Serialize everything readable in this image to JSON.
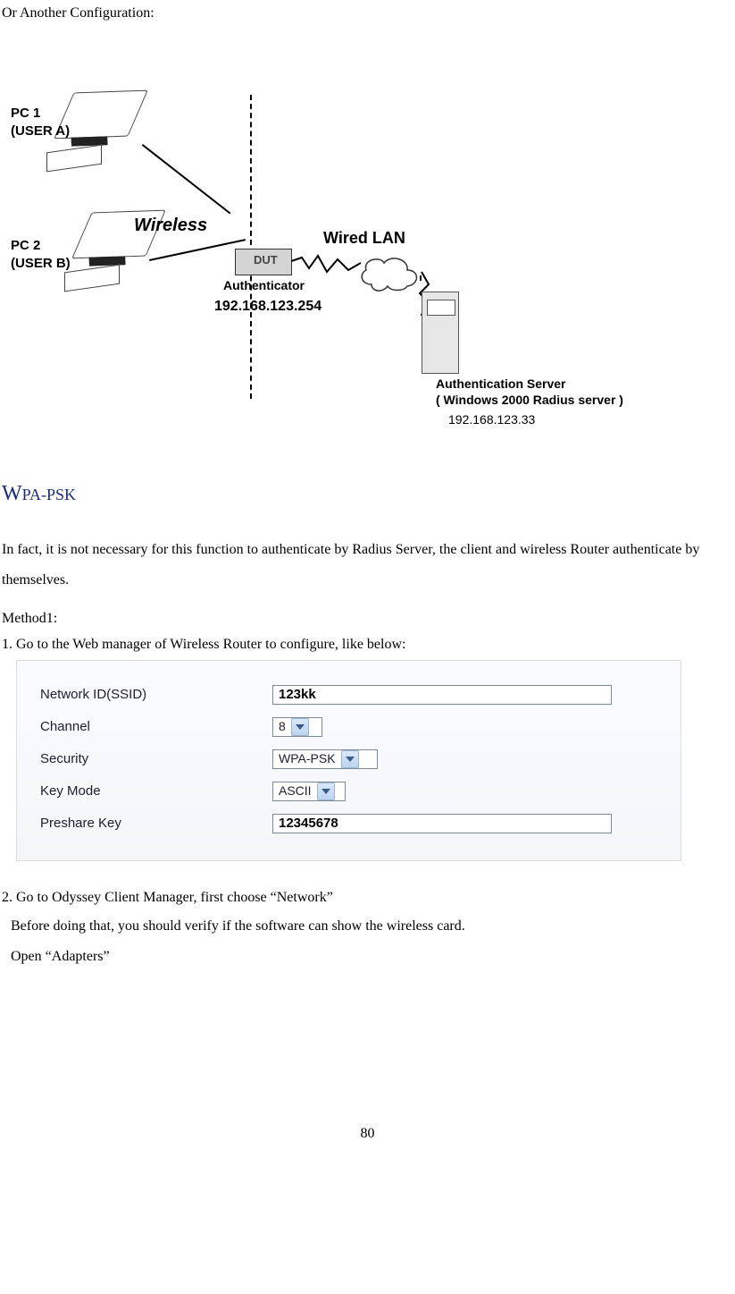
{
  "page": {
    "intro": "Or Another Configuration:",
    "page_number": "80"
  },
  "diagram": {
    "pc1_name": "PC 1",
    "pc1_user": "(USER A)",
    "pc2_name": "PC 2",
    "pc2_user": "(USER B)",
    "wireless_label": "Wireless",
    "dut": "DUT",
    "authenticator": "Authenticator",
    "dut_ip": "192.168.123.254",
    "wired_lan": "Wired  LAN",
    "auth_server_line1": "Authentication Server",
    "auth_server_line2": "( Windows 2000 Radius server )",
    "auth_server_ip": "192.168.123.33"
  },
  "wpa": {
    "heading": "PA-PSK",
    "heading_big": "W",
    "para": "In fact, it is not necessary for this function to authenticate by Radius Server, the client and wireless Router authenticate by themselves.",
    "method1": "Method1:",
    "step1": "1. Go to the Web manager of Wireless Router to configure, like below:",
    "step2": "2. Go to Odyssey Client Manager, first choose “Network”",
    "step2a": "Before doing that, you should verify if the software can show the wireless card.",
    "step2b": "Open “Adapters”"
  },
  "form": {
    "ssid_label": "Network ID(SSID)",
    "ssid_value": "123kk",
    "channel_label": "Channel",
    "channel_value": "8",
    "security_label": "Security",
    "security_value": "WPA-PSK",
    "keymode_label": "Key Mode",
    "keymode_value": "ASCII",
    "preshare_label": "Preshare Key",
    "preshare_value": "12345678"
  }
}
